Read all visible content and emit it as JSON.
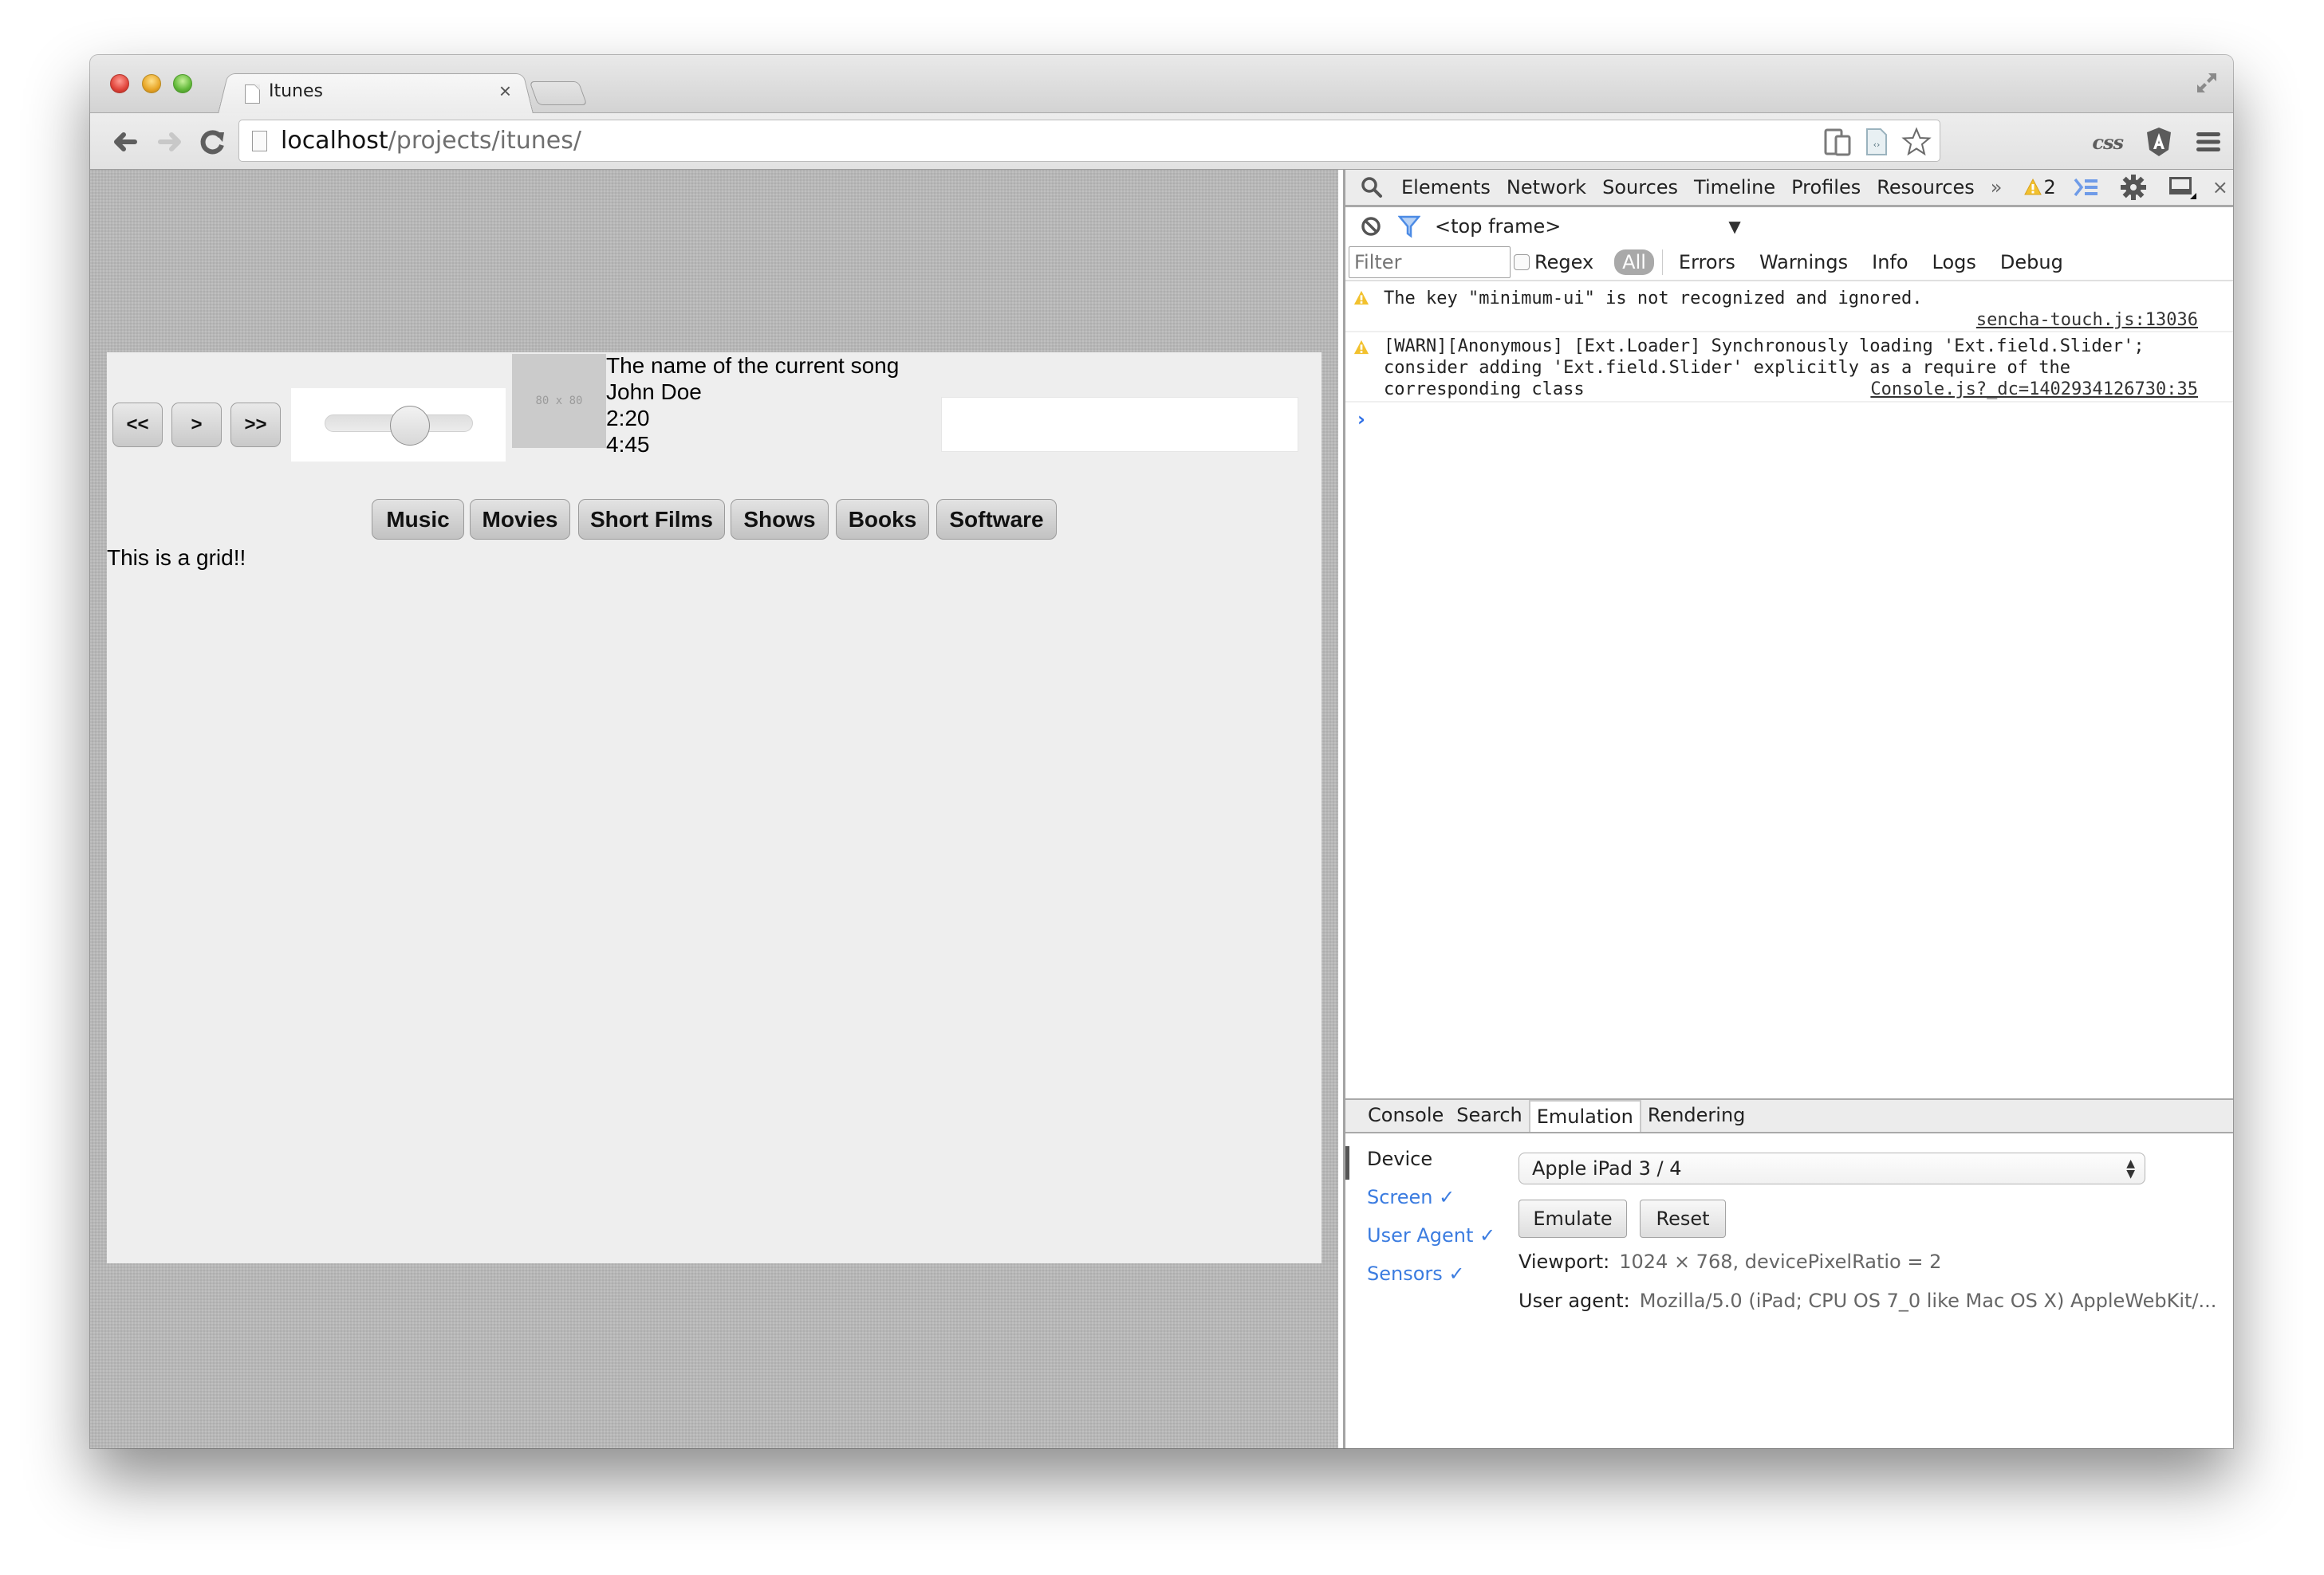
{
  "browser": {
    "tab_title": "Itunes",
    "url_host": "localhost",
    "url_path": "/projects/itunes/",
    "extensions": {
      "css_label": "css"
    }
  },
  "player": {
    "prev_label": "<<",
    "play_label": ">",
    "next_label": ">>",
    "slider_value_fraction": 0.6,
    "art_placeholder": "80 x 80",
    "song_title": "The name of the current song",
    "artist": "John Doe",
    "elapsed": "2:20",
    "duration": "4:45"
  },
  "categories": [
    {
      "label": "Music"
    },
    {
      "label": "Movies"
    },
    {
      "label": "Short Films"
    },
    {
      "label": "Shows"
    },
    {
      "label": "Books"
    },
    {
      "label": "Software"
    }
  ],
  "grid_text": "This is a grid!!",
  "devtools": {
    "panels": [
      "Elements",
      "Network",
      "Sources",
      "Timeline",
      "Profiles",
      "Resources"
    ],
    "more_label": "»",
    "warning_count": "2",
    "frame_selector": "<top frame>",
    "filter_placeholder": "Filter",
    "regex_label": "Regex",
    "levels": {
      "all": "All",
      "errors": "Errors",
      "warnings": "Warnings",
      "info": "Info",
      "logs": "Logs",
      "debug": "Debug"
    },
    "messages": [
      {
        "level": "warning",
        "text": "The key \"minimum-ui\" is not recognized and ignored.",
        "source": "sencha-touch.js:13036"
      },
      {
        "level": "warning",
        "lines": [
          "[WARN][Anonymous] [Ext.Loader] Synchronously loading 'Ext.field.Slider';",
          "consider adding 'Ext.field.Slider' explicitly as a require of the",
          "corresponding class"
        ],
        "source": "Console.js?_dc=1402934126730:35"
      }
    ],
    "prompt_symbol": "›",
    "drawer_tabs": [
      "Console",
      "Search",
      "Emulation",
      "Rendering"
    ],
    "active_drawer_tab": "Emulation",
    "emulation": {
      "sidebar": [
        {
          "label": "Device",
          "active": true
        },
        {
          "label": "Screen ✓"
        },
        {
          "label": "User Agent ✓"
        },
        {
          "label": "Sensors ✓"
        }
      ],
      "device_selected": "Apple iPad 3 / 4",
      "emulate_label": "Emulate",
      "reset_label": "Reset",
      "viewport_label": "Viewport:",
      "viewport_value": "1024 × 768, devicePixelRatio = 2",
      "user_agent_label": "User agent:",
      "user_agent_value": "Mozilla/5.0 (iPad; CPU OS 7_0 like Mac OS X) AppleWebKit/..."
    }
  },
  "colors": {
    "accent_blue": "#3b7ce0",
    "warning_yellow": "#f2c12e"
  }
}
